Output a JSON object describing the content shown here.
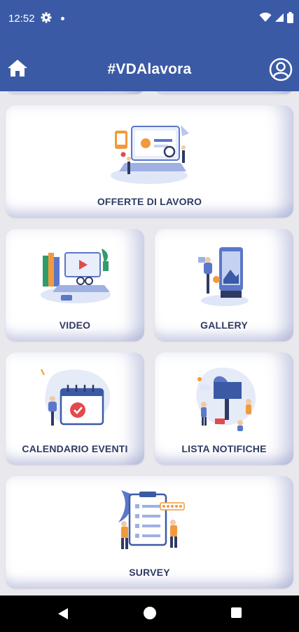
{
  "status_bar": {
    "time": "12:52"
  },
  "app_bar": {
    "title": "#VDAlavora"
  },
  "tiles": {
    "offerte": "OFFERTE DI LAVORO",
    "video": "VIDEO",
    "gallery": "GALLERY",
    "calendario": "CALENDARIO EVENTI",
    "notifiche": "LISTA NOTIFICHE",
    "survey": "SURVEY"
  },
  "colors": {
    "primary": "#3b5aa6",
    "label": "#2f3a63",
    "background": "#e9e9ed",
    "accent_orange": "#f29a3b",
    "accent_red": "#e24b4b"
  },
  "icons": [
    "gear-icon",
    "wifi-icon",
    "signal-icon",
    "battery-icon",
    "home-icon",
    "account-icon",
    "back-icon",
    "home-nav-icon",
    "recents-icon"
  ]
}
